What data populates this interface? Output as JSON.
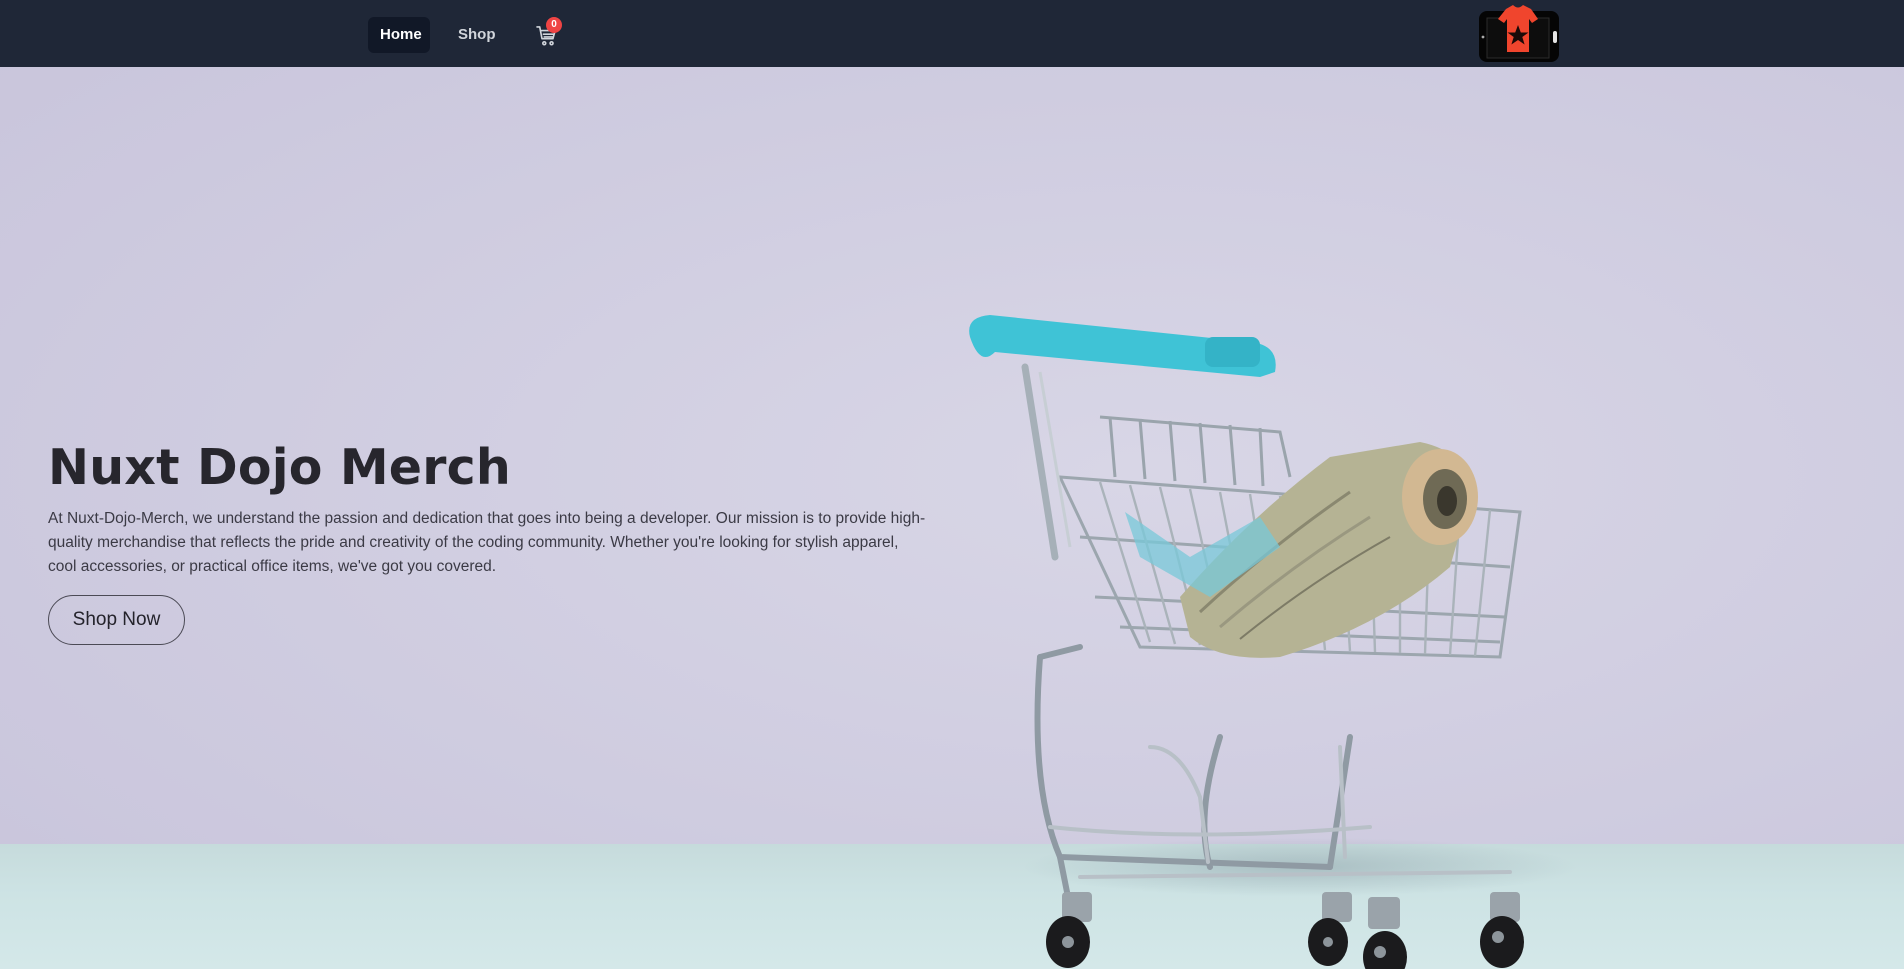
{
  "nav": {
    "home_label": "Home",
    "shop_label": "Shop",
    "cart_count": "0",
    "cart_icon": "shopping-cart-icon",
    "logo_icon": "phone-tshirt-star-logo"
  },
  "hero": {
    "title": "Nuxt Dojo Merch",
    "description": "At Nuxt-Dojo-Merch, we understand the passion and dedication that goes into being a developer. Our mission is to provide high-quality merchandise that reflects the pride and creativity of the coding community. Whether you're looking for stylish apparel, cool accessories, or practical office items, we've got you covered.",
    "cta_label": "Shop Now",
    "image": "shopping-cart-with-money-photo"
  },
  "colors": {
    "navbar": "#1f2737",
    "active_link_bg": "#111827",
    "badge": "#ef4444",
    "hero_bg": "#d3d1e2",
    "floor": "#cde3e4",
    "cart_handle": "#3fc3d6",
    "logo_red": "#f0452d"
  }
}
